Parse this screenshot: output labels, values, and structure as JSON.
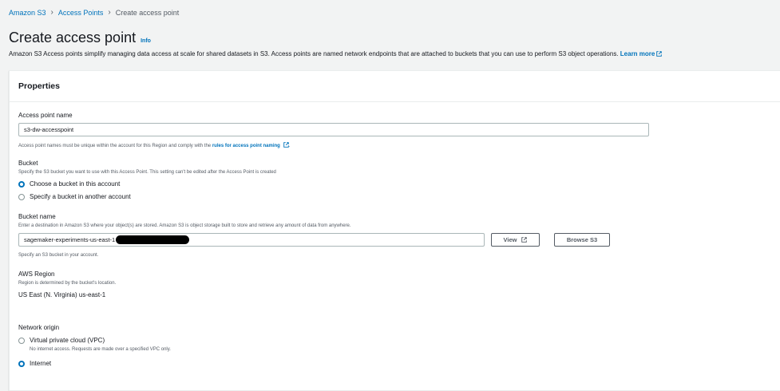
{
  "breadcrumb": {
    "items": [
      "Amazon S3",
      "Access Points"
    ],
    "current": "Create access point"
  },
  "page": {
    "title": "Create access point",
    "info": "Info",
    "description": "Amazon S3 Access points simplify managing data access at scale for shared datasets in S3. Access points are named network endpoints that are attached to buckets that you can use to perform S3 object operations.",
    "learn_more": "Learn more"
  },
  "properties": {
    "heading": "Properties",
    "access_point_name": {
      "label": "Access point name",
      "value": "s3-dw-accesspoint",
      "hint_prefix": "Access point names must be unique within the account for this Region and comply with the",
      "hint_link": "rules for access point naming",
      "hint_suffix": "."
    },
    "bucket": {
      "label": "Bucket",
      "hint": "Specify the S3 bucket you want to use with this Access Point. This setting can't be edited after the Access Point is created",
      "options": [
        "Choose a bucket in this account",
        "Specify a bucket in another account"
      ],
      "selected": 0
    },
    "bucket_name": {
      "label": "Bucket name",
      "hint": "Enter a destination in Amazon S3 where your object(s) are stored. Amazon S3 is object storage built to store and retrieve any amount of data from anywhere.",
      "value": "sagemaker-experiments-us-east-1",
      "view_button": "View",
      "browse_button": "Browse S3",
      "footer_hint": "Specify an S3 bucket in your account."
    },
    "aws_region": {
      "label": "AWS Region",
      "hint": "Region is determined by the bucket's location.",
      "value": "US East (N. Virginia) us-east-1"
    },
    "network_origin": {
      "label": "Network origin",
      "options": [
        {
          "label": "Virtual private cloud (VPC)",
          "description": "No internet access. Requests are made over a specified VPC only."
        },
        {
          "label": "Internet",
          "description": ""
        }
      ],
      "selected": 1
    }
  },
  "colors": {
    "link": "#0073bb",
    "background": "#f2f3f3",
    "panel": "#ffffff",
    "text": "#16191f",
    "muted": "#545b64"
  }
}
